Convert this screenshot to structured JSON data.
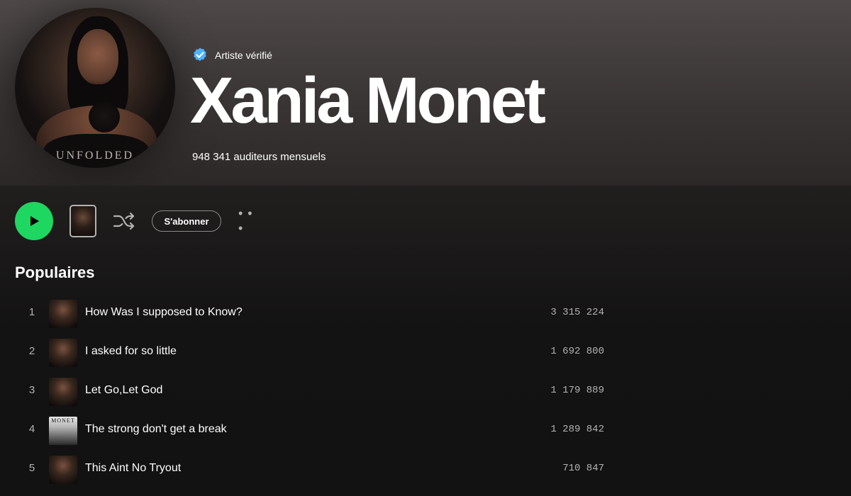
{
  "header": {
    "verified_label": "Artiste vérifié",
    "artist_name": "Xania Monet",
    "monthly_listeners": "948 341 auditeurs mensuels",
    "artist_image_text": "UNFOLDED"
  },
  "controls": {
    "subscribe_label": "S'abonner",
    "more_label": "• • •"
  },
  "popular": {
    "title": "Populaires",
    "tracks": [
      {
        "num": "1",
        "title": "How Was I supposed to Know?",
        "plays": "3 315 224"
      },
      {
        "num": "2",
        "title": "I asked for so little",
        "plays": "1 692 800"
      },
      {
        "num": "3",
        "title": "Let Go,Let God",
        "plays": "1 179 889"
      },
      {
        "num": "4",
        "title": "The strong don't get a break",
        "plays": "1 289 842",
        "art_text": "MONET"
      },
      {
        "num": "5",
        "title": "This Aint No Tryout",
        "plays": "710 847"
      }
    ]
  },
  "colors": {
    "accent": "#1ed760",
    "verified": "#4cb3ff",
    "background": "#121212",
    "secondary_text": "#b3b3b3"
  },
  "icons": {
    "verified": "verified-badge-icon",
    "play": "play-icon",
    "shuffle": "shuffle-icon",
    "more": "more-icon"
  }
}
